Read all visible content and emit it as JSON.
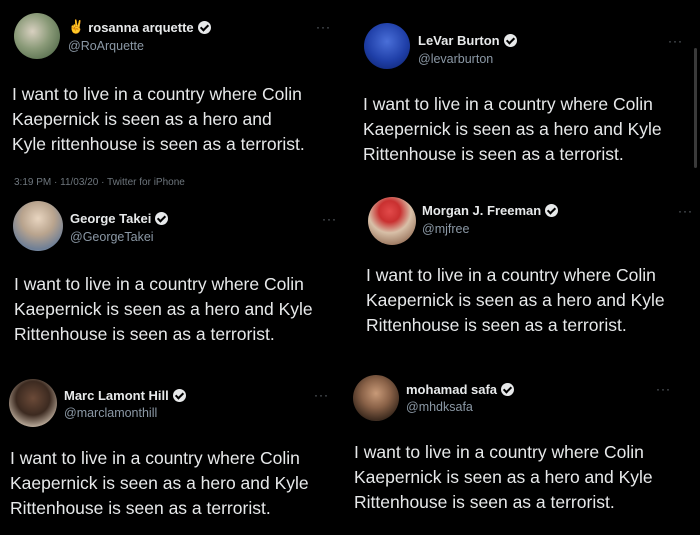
{
  "tweets": [
    {
      "name_prefix": "✌",
      "name": "rosanna arquette",
      "handle": "@RoArquette",
      "text": "I want to live in a country where Colin\nKaepernick  is seen as a hero and\nKyle rittenhouse is seen as a terrorist.",
      "meta": "3:19 PM · 11/03/20 · Twitter for iPhone",
      "more": "···"
    },
    {
      "name": "LeVar Burton",
      "handle": "@levarburton",
      "text": "I want to live in a country where Colin\nKaepernick is seen as a hero and Kyle\nRittenhouse is seen as a terrorist.",
      "more": "···"
    },
    {
      "name": "George Takei",
      "handle": "@GeorgeTakei",
      "text": "I want to live in a country where Colin\nKaepernick is seen as a hero and Kyle\nRittenhouse is seen as a terrorist.",
      "more": "···"
    },
    {
      "name": "Morgan J. Freeman",
      "handle": "@mjfree",
      "text": "I want to live in a country where Colin\nKaepernick is seen as a hero and Kyle\nRittenhouse is seen as a terrorist.",
      "more": "···"
    },
    {
      "name": "Marc Lamont Hill",
      "handle": "@marclamonthill",
      "text": "I want to live in a country where Colin\nKaepernick is seen as a hero and Kyle\nRittenhouse is seen as a terrorist.",
      "more": "···"
    },
    {
      "name": "mohamad safa",
      "handle": "@mhdksafa",
      "text": "I want to live in a country where Colin\nKaepernick is seen as a hero and Kyle\nRittenhouse is seen as a terrorist.",
      "more": "···"
    }
  ],
  "colors": {
    "background": "#000000",
    "text": "#e7e9ea",
    "secondary": "#8b98a5"
  }
}
